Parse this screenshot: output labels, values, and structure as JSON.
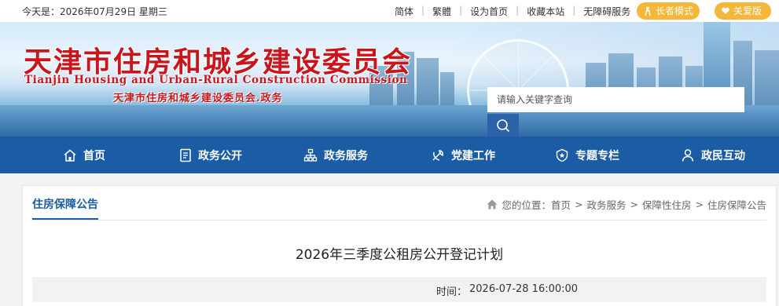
{
  "topbar": {
    "today": "今天是：2026年07月29日 星期三",
    "links": [
      "简体",
      "繁體",
      "设为首页",
      "收藏本站",
      "无障碍服务"
    ],
    "elder_mode": "长者模式",
    "care_version": "关爱版"
  },
  "banner": {
    "title_cn": "天津市住房和城乡建设委员会",
    "title_en": "Tianjin Housing and Urban-Rural Construction Commission",
    "subtitle": "天津市住房和城乡建设委员会.政务"
  },
  "search": {
    "placeholder": "请输入关键字查询",
    "icon": "search-icon"
  },
  "nav": {
    "items": [
      {
        "label": "首页",
        "icon": "home-icon"
      },
      {
        "label": "政务公开",
        "icon": "document-icon"
      },
      {
        "label": "政务服务",
        "icon": "org-chart-icon"
      },
      {
        "label": "党建工作",
        "icon": "party-emblem-icon"
      },
      {
        "label": "专题专栏",
        "icon": "badge-icon"
      },
      {
        "label": "政民互动",
        "icon": "user-icon"
      }
    ]
  },
  "section": {
    "title": "住房保障公告",
    "breadcrumb_prefix": "您的位置：",
    "breadcrumb": [
      "首页",
      "政务服务",
      "保障性住房",
      "住房保障公告"
    ],
    "separator": ">"
  },
  "article": {
    "title": "2026年三季度公租房公开登记计划",
    "time_label": "时间：",
    "time_value": "2026-07-28 16:00:00"
  },
  "colors": {
    "nav_blue": "#1b5ca5",
    "title_red": "#c8161d",
    "pill_orange": "#f4b73a"
  }
}
